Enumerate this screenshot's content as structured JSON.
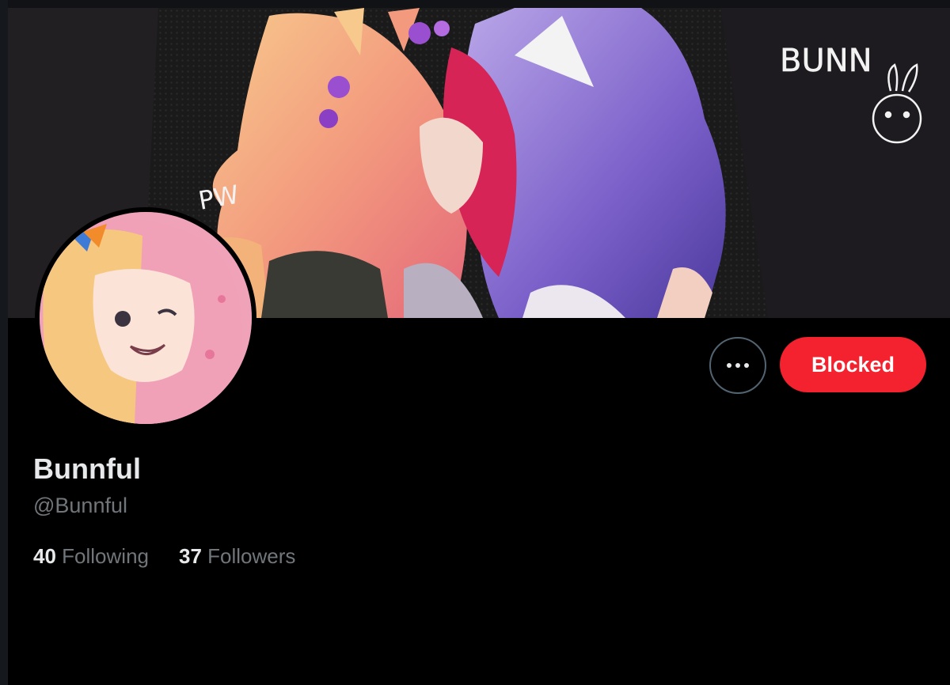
{
  "profile": {
    "display_name": "Bunnful",
    "handle": "@Bunnful",
    "following_count": "40",
    "following_label": "Following",
    "followers_count": "37",
    "followers_label": "Followers"
  },
  "actions": {
    "more_icon": "more-horizontal-icon",
    "blocked_label": "Blocked"
  },
  "banner": {
    "signature_text": "BUNN",
    "artist_mark": "PW"
  },
  "colors": {
    "background": "#000000",
    "blocked_button": "#f4212e",
    "primary_text": "#e7e9ea",
    "secondary_text": "#71767b",
    "button_border": "#536471"
  }
}
